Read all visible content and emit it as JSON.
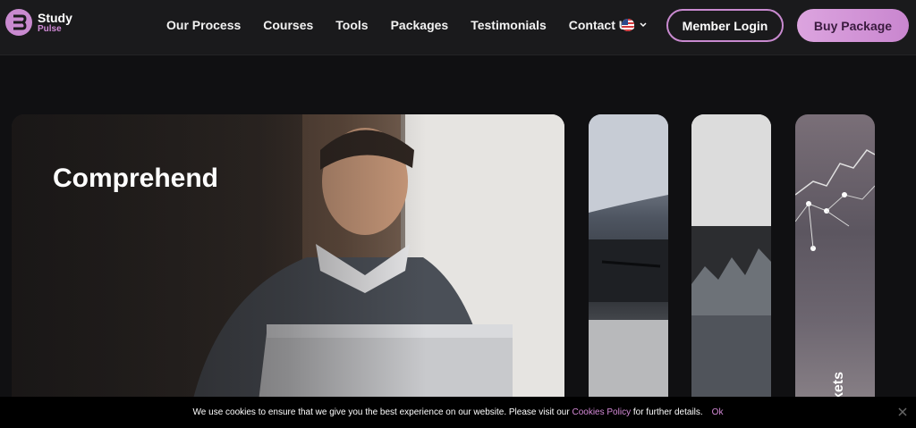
{
  "header": {
    "logo_title": "Study",
    "logo_sub": "Pulse",
    "nav": [
      "Our Process",
      "Courses",
      "Tools",
      "Packages",
      "Testimonials",
      "Contact Us"
    ],
    "language_icon": "us-flag-icon",
    "member_login": "Member Login",
    "buy_package": "Buy Package"
  },
  "cards": {
    "main_title": "Comprehend",
    "card4_label": "kets"
  },
  "cookie": {
    "text_before": "We use cookies to ensure that we give you the best experience on our website. Please visit our ",
    "link": "Cookies Policy",
    "text_after": " for further details.",
    "ok": "Ok"
  },
  "colors": {
    "accent": "#c98ad0",
    "background": "#101012",
    "header": "#1a1a1c"
  }
}
